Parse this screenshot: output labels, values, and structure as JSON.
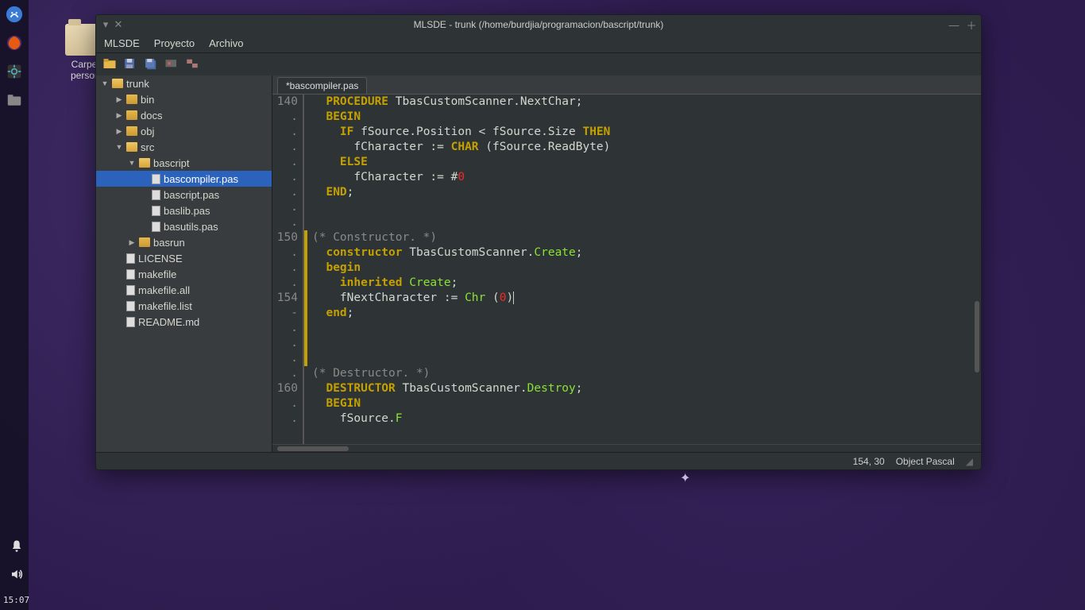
{
  "desktop": {
    "folder_label": "Carpe\npersor"
  },
  "taskbar": {
    "clock": "15:07"
  },
  "window": {
    "title": "MLSDE - trunk (/home/burdjia/programacion/bascript/trunk)",
    "menus": [
      "MLSDE",
      "Proyecto",
      "Archivo"
    ],
    "statusbar": {
      "position": "154, 30",
      "mode": "Object Pascal"
    },
    "tab": "*bascompiler.pas"
  },
  "tree": [
    {
      "level": 0,
      "arrow": "▼",
      "icon": "folder-open",
      "label": "trunk"
    },
    {
      "level": 1,
      "arrow": "▶",
      "icon": "folder",
      "label": "bin"
    },
    {
      "level": 1,
      "arrow": "▶",
      "icon": "folder",
      "label": "docs"
    },
    {
      "level": 1,
      "arrow": "▶",
      "icon": "folder",
      "label": "obj"
    },
    {
      "level": 1,
      "arrow": "▼",
      "icon": "folder-open",
      "label": "src"
    },
    {
      "level": 2,
      "arrow": "▼",
      "icon": "folder-open",
      "label": "bascript"
    },
    {
      "level": 3,
      "arrow": "",
      "icon": "file",
      "label": "bascompiler.pas",
      "selected": true
    },
    {
      "level": 3,
      "arrow": "",
      "icon": "file",
      "label": "bascript.pas"
    },
    {
      "level": 3,
      "arrow": "",
      "icon": "file",
      "label": "baslib.pas"
    },
    {
      "level": 3,
      "arrow": "",
      "icon": "file",
      "label": "basutils.pas"
    },
    {
      "level": 2,
      "arrow": "▶",
      "icon": "folder",
      "label": "basrun"
    },
    {
      "level": 1,
      "arrow": "",
      "icon": "file",
      "label": "LICENSE"
    },
    {
      "level": 1,
      "arrow": "",
      "icon": "file",
      "label": "makefile"
    },
    {
      "level": 1,
      "arrow": "",
      "icon": "file",
      "label": "makefile.all"
    },
    {
      "level": 1,
      "arrow": "",
      "icon": "file",
      "label": "makefile.list"
    },
    {
      "level": 1,
      "arrow": "",
      "icon": "file",
      "label": "README.md"
    }
  ],
  "code": {
    "gutters": [
      "140",
      ".",
      ".",
      ".",
      ".",
      ".",
      ".",
      ".",
      ".",
      "150",
      ".",
      ".",
      ".",
      "154",
      "-",
      ".",
      ".",
      ".",
      ".",
      "160",
      ".",
      "."
    ],
    "yellow": [
      0,
      0,
      0,
      0,
      0,
      0,
      0,
      0,
      0,
      1,
      1,
      1,
      1,
      1,
      1,
      1,
      1,
      1,
      0,
      0,
      0,
      0
    ],
    "lines": [
      {
        "t": "  PROCEDURE TbasCustomScanner.NextChar;",
        "spans": [
          [
            "  ",
            ""
          ],
          [
            "PROCEDURE",
            "kw2"
          ],
          [
            " TbasCustomScanner.NextChar;",
            ""
          ]
        ]
      },
      {
        "t": "  BEGIN",
        "spans": [
          [
            "  ",
            ""
          ],
          [
            "BEGIN",
            "kw2"
          ]
        ]
      },
      {
        "t": "    IF fSource.Position < fSource.Size THEN",
        "spans": [
          [
            "    ",
            ""
          ],
          [
            "IF",
            "kw2"
          ],
          [
            " fSource.Position < fSource.Size ",
            ""
          ],
          [
            "THEN",
            "kw2"
          ]
        ]
      },
      {
        "t": "      fCharacter := CHAR (fSource.ReadByte)",
        "spans": [
          [
            "      fCharacter := ",
            ""
          ],
          [
            "CHAR",
            "kw2"
          ],
          [
            " (fSource.ReadByte)",
            ""
          ]
        ]
      },
      {
        "t": "    ELSE",
        "spans": [
          [
            "    ",
            ""
          ],
          [
            "ELSE",
            "kw2"
          ]
        ]
      },
      {
        "t": "      fCharacter := #0",
        "spans": [
          [
            "      fCharacter := #",
            ""
          ],
          [
            "0",
            "num"
          ]
        ]
      },
      {
        "t": "  END;",
        "spans": [
          [
            "  ",
            ""
          ],
          [
            "END",
            "kw2"
          ],
          [
            ";",
            ""
          ]
        ]
      },
      {
        "t": "",
        "spans": [
          [
            "",
            ""
          ]
        ]
      },
      {
        "t": "",
        "spans": [
          [
            "",
            ""
          ]
        ]
      },
      {
        "t": "(* Constructor. *)",
        "spans": [
          [
            "(* Constructor. *)",
            "cm"
          ]
        ]
      },
      {
        "t": "  constructor TbasCustomScanner.Create;",
        "spans": [
          [
            "  ",
            ""
          ],
          [
            "constructor",
            "kw2"
          ],
          [
            " TbasCustomScanner.",
            ""
          ],
          [
            "Create",
            "fn"
          ],
          [
            ";",
            ""
          ]
        ]
      },
      {
        "t": "  begin",
        "spans": [
          [
            "  ",
            ""
          ],
          [
            "begin",
            "kw2"
          ]
        ]
      },
      {
        "t": "    inherited Create;",
        "spans": [
          [
            "    ",
            ""
          ],
          [
            "inherited",
            "kw2"
          ],
          [
            " ",
            ""
          ],
          [
            "Create",
            "fn"
          ],
          [
            ";",
            ""
          ]
        ]
      },
      {
        "t": "    fNextCharacter := Chr (0)",
        "spans": [
          [
            "    fNextCharacter := ",
            ""
          ],
          [
            "Chr",
            "fn"
          ],
          [
            " (",
            ""
          ],
          [
            "0",
            "num"
          ],
          [
            ")",
            ""
          ]
        ],
        "caret": true
      },
      {
        "t": "  end;",
        "spans": [
          [
            "  ",
            ""
          ],
          [
            "end",
            "kw2"
          ],
          [
            ";",
            ""
          ]
        ]
      },
      {
        "t": "",
        "spans": [
          [
            "",
            ""
          ]
        ]
      },
      {
        "t": "",
        "spans": [
          [
            "",
            ""
          ]
        ]
      },
      {
        "t": "",
        "spans": [
          [
            "",
            ""
          ]
        ]
      },
      {
        "t": "(* Destructor. *)",
        "spans": [
          [
            "(* Destructor. *)",
            "cm"
          ]
        ]
      },
      {
        "t": "  DESTRUCTOR TbasCustomScanner.Destroy;",
        "spans": [
          [
            "  ",
            ""
          ],
          [
            "DESTRUCTOR",
            "kw2"
          ],
          [
            " TbasCustomScanner.",
            ""
          ],
          [
            "Destroy",
            "fn"
          ],
          [
            ";",
            ""
          ]
        ]
      },
      {
        "t": "  BEGIN",
        "spans": [
          [
            "  ",
            ""
          ],
          [
            "BEGIN",
            "kw2"
          ]
        ]
      },
      {
        "t": "    fSource.F",
        "spans": [
          [
            "    fSource.",
            ""
          ],
          [
            "F",
            "fn"
          ]
        ]
      }
    ]
  }
}
